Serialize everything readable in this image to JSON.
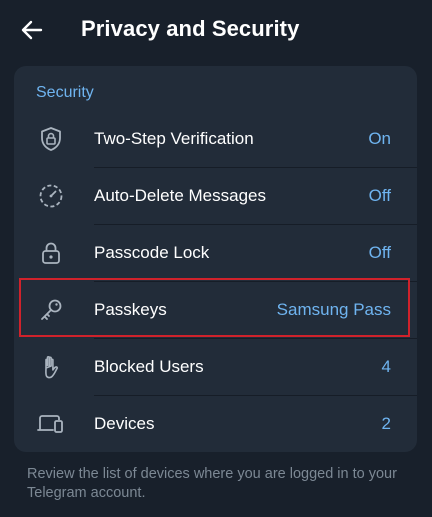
{
  "header": {
    "title": "Privacy and Security"
  },
  "security": {
    "section_title": "Security",
    "items": [
      {
        "label": "Two-Step Verification",
        "value": "On",
        "icon": "shield-lock-icon"
      },
      {
        "label": "Auto-Delete Messages",
        "value": "Off",
        "icon": "timer-icon"
      },
      {
        "label": "Passcode Lock",
        "value": "Off",
        "icon": "lock-icon"
      },
      {
        "label": "Passkeys",
        "value": "Samsung Pass",
        "icon": "key-icon"
      },
      {
        "label": "Blocked Users",
        "value": "4",
        "icon": "hand-icon"
      },
      {
        "label": "Devices",
        "value": "2",
        "icon": "devices-icon"
      }
    ]
  },
  "footer_text": "Review the list of devices where you are logged in to your Telegram account.",
  "colors": {
    "background": "#18202b",
    "card": "#222c39",
    "accent": "#6fb4f0",
    "highlight": "#d0222b"
  }
}
